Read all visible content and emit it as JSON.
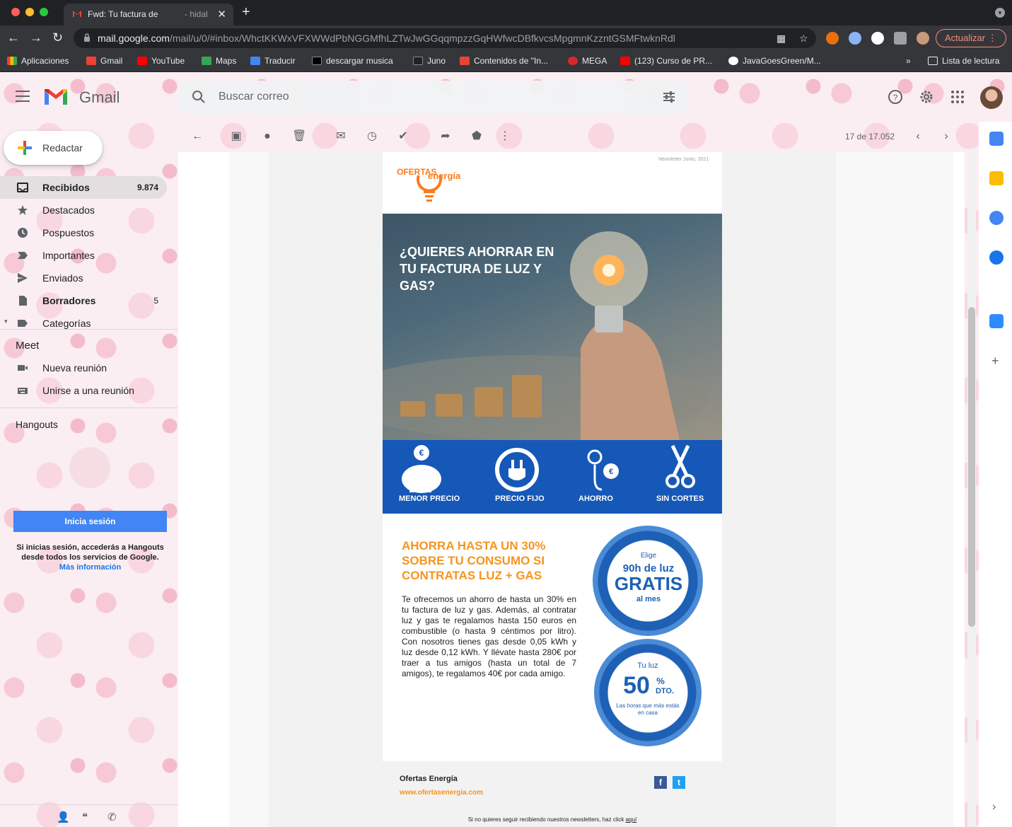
{
  "browser": {
    "tab_title": "Fwd: Tu factura de",
    "tab_title_cont": "- hidal",
    "url_domain": "mail.google.com",
    "url_path": "/mail/u/0/#inbox/WhctKKWxVFXWWdPbNGGMfhLZTwJwGGqqmpzzGqHWfwcDBfkvcsMpgmnKzzntGSMFtwknRdl",
    "update_label": "Actualizar",
    "bookmarks": [
      "Aplicaciones",
      "Gmail",
      "YouTube",
      "Maps",
      "Traducir",
      "descargar musica",
      "Juno",
      "Contenidos de \"In...",
      "MEGA",
      "(123) Curso de PR...",
      "JavaGoesGreen/M..."
    ],
    "reading_list": "Lista de lectura",
    "overflow": "»"
  },
  "gmail": {
    "product_name": "Gmail",
    "search_placeholder": "Buscar correo",
    "compose_label": "Redactar",
    "nav": [
      {
        "label": "Recibidos",
        "count": "9.874",
        "icon": "inbox-icon"
      },
      {
        "label": "Destacados",
        "count": "",
        "icon": "star-icon"
      },
      {
        "label": "Pospuestos",
        "count": "",
        "icon": "clock-icon"
      },
      {
        "label": "Importantes",
        "count": "",
        "icon": "important-icon"
      },
      {
        "label": "Enviados",
        "count": "",
        "icon": "send-icon"
      },
      {
        "label": "Borradores",
        "count": "5",
        "icon": "draft-icon"
      },
      {
        "label": "Categorías",
        "count": "",
        "icon": "label-icon"
      }
    ],
    "meet": {
      "heading": "Meet",
      "items": [
        "Nueva reunión",
        "Unirse a una reunión"
      ]
    },
    "hangouts": {
      "heading": "Hangouts",
      "signin_label": "Inicia sesión",
      "note": "Si inicias sesión, accederás a Hangouts desde todos los servicios de Google.",
      "more_info": "Más información"
    },
    "pager": "17 de 17.052"
  },
  "newsletter": {
    "date": "Newsletter Junio, 2021",
    "logo_word1": "OFERTAS",
    "logo_word2": "energía",
    "hero_title": "¿QUIERES AHORRAR EN TU FACTURA DE LUZ Y GAS?",
    "features": [
      "MENOR PRECIO",
      "PRECIO FIJO",
      "AHORRO",
      "SIN CORTES"
    ],
    "offer_title": "AHORRA HASTA UN 30% SOBRE TU CONSUMO SI CONTRATAS LUZ + GAS",
    "offer_body": "Te ofrecemos un ahorro de hasta un 30% en tu factura de luz y gas. Además, al contratar luz y gas te regalamos hasta 150 euros en combustible (o hasta 9 céntimos por litro). Con nosotros tienes gas desde 0,05 kWh y luz desde 0,12 kWh. Y llévate hasta 280€ por traer a tus amigos (hasta un total de 7 amigos), te regalamos 40€ por cada amigo.",
    "badge1": {
      "top": "Elige",
      "mid": "90h de luz",
      "big": "GRATIS",
      "bottom": "al mes"
    },
    "badge2": {
      "top": "Tu luz",
      "big": "50",
      "pct": "%",
      "dto": "DTO.",
      "bottom": "Las horas que más estás en casa"
    },
    "footer_name": "Ofertas Energía",
    "footer_url": "www.ofertasenergia.com",
    "unsubscribe_text": "Si no quieres seguir recibiendo nuestros newsletters, haz click",
    "unsubscribe_link": "aquí"
  },
  "colors": {
    "accent_orange": "#f7931e",
    "feature_blue": "#1658b8",
    "gmail_blue": "#4285f4"
  }
}
